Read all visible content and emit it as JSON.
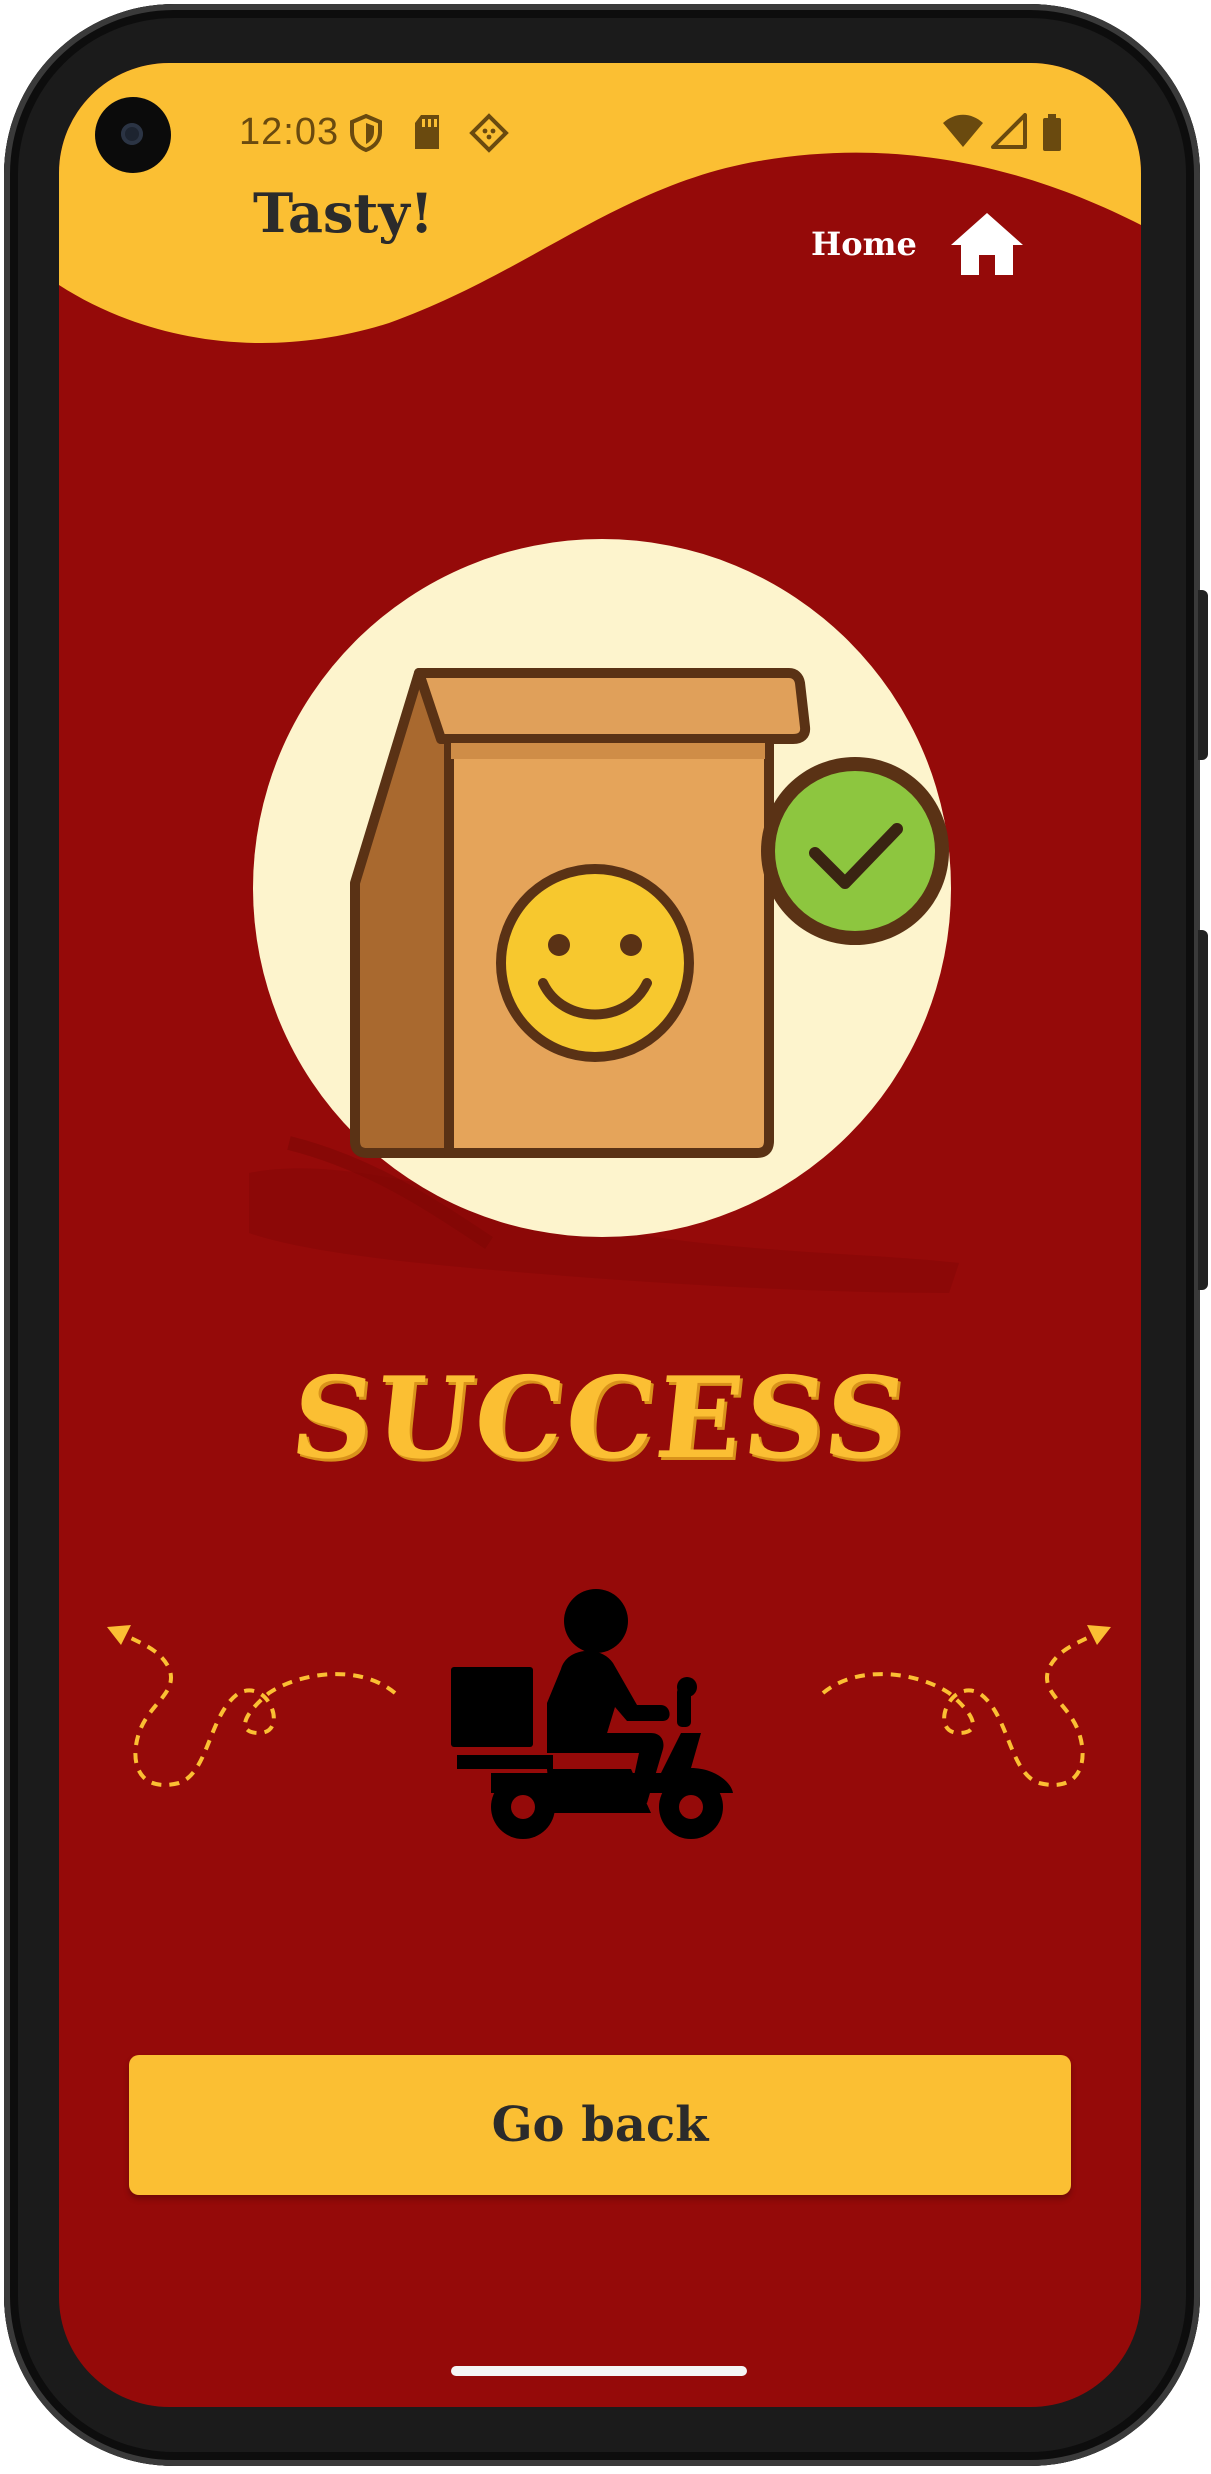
{
  "status_bar": {
    "time": "12:03",
    "left_icons": [
      "shield-icon",
      "sd-card-icon",
      "chip-icon"
    ],
    "right_icons": [
      "wifi-icon",
      "signal-icon",
      "battery-icon"
    ]
  },
  "header": {
    "app_title": "Tasty!",
    "nav_home_label": "Home",
    "nav_home_icon": "house-icon"
  },
  "main": {
    "illustration": "paper-bag-smiley-check-icon",
    "success_text": "SUCCESS",
    "delivery_icon": "scooter-delivery-icon",
    "decorations": [
      "dashed-arrow-left",
      "dashed-arrow-right"
    ]
  },
  "actions": {
    "go_back_label": "Go back"
  },
  "colors": {
    "background": "#950a09",
    "accent_yellow": "#fbbf33",
    "circle_cream": "#fdf4cd",
    "dark_text": "#2b2b2b",
    "check_green": "#8dc63f",
    "smiley_yellow": "#f7c82e"
  }
}
